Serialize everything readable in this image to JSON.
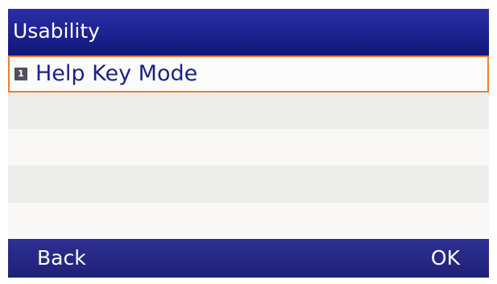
{
  "screen": {
    "title": "Usability"
  },
  "menu": {
    "items": [
      {
        "number": "1",
        "label": "Help Key Mode",
        "selected": true
      }
    ]
  },
  "softkeys": {
    "left": "Back",
    "right": "OK"
  },
  "colors": {
    "title_bar": "#1c2290",
    "softkey_bar": "#262884",
    "selection_border": "#ec7d2f",
    "item_text": "#1b2288"
  }
}
